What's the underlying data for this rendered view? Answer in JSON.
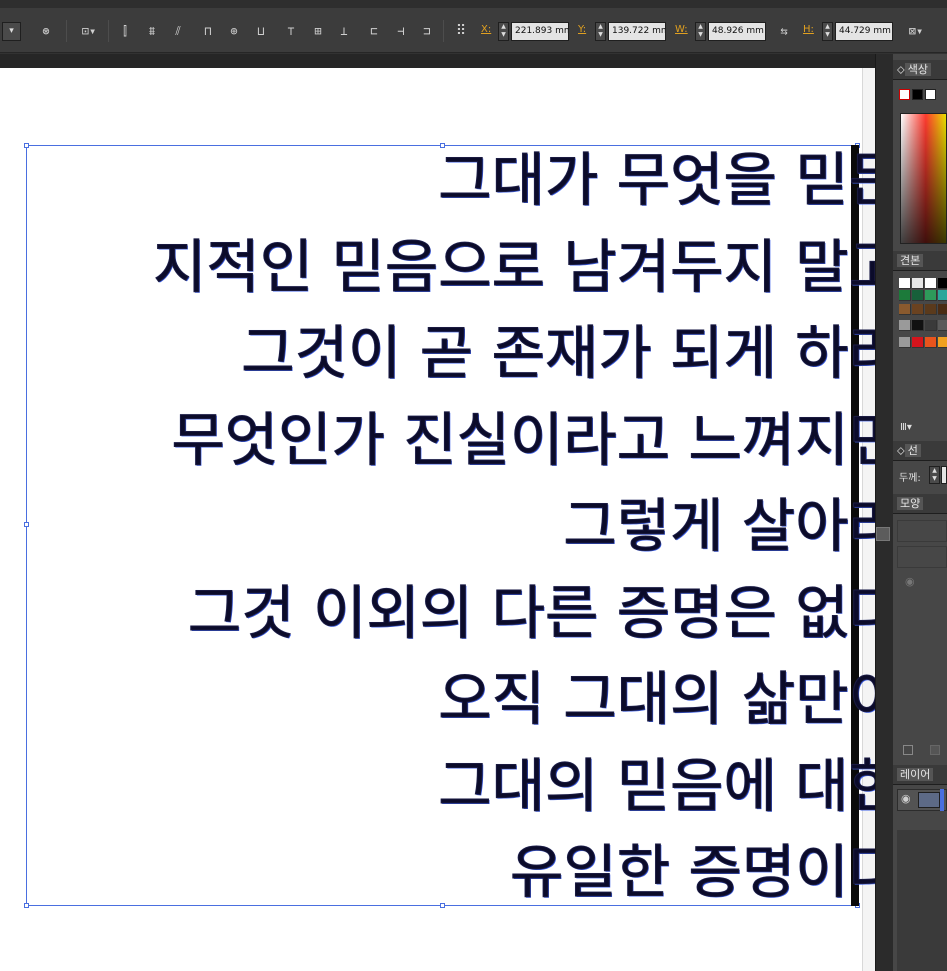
{
  "toolbar": {
    "stroke_dropdown_arrow": "▾",
    "globe_icon": "⊛",
    "transform_icon": "⊡▾",
    "align_icons": [
      "⫿",
      "⩩",
      "⫽",
      "⊓",
      "⊕",
      "⊔",
      "⊤",
      "⊞",
      "⊥",
      "⊏",
      "⊣",
      "⊐"
    ],
    "grid_icon": "⠿",
    "x_label": "X:",
    "y_label": "Y:",
    "w_label": "W:",
    "h_label": "H:",
    "x_value": "221.893 mm",
    "y_value": "139.722 mm",
    "w_value": "48.926 mm",
    "h_value": "44.729 mm",
    "link_icon": "⇆",
    "transform_menu_icon": "⊠▾"
  },
  "document": {
    "lines": [
      "그대가 무엇을 믿든",
      "지적인 믿음으로 남겨두지 말고",
      "그것이 곧 존재가 되게 하라",
      "무엇인가 진실이라고 느껴지면",
      "그렇게 살아라",
      "그것 이외의 다른 증명은 없다",
      "오직 그대의 삶만이",
      "그대의 믿음에 대한",
      "유일한 증명이다"
    ]
  },
  "panels": {
    "color_tab": "색상",
    "swatches_tab": "견본",
    "stroke_tab": "선",
    "stroke_weight_label": "두께:",
    "appearance_tab": "모양",
    "layers_tab": "레이어",
    "library_icon": "Ⅲ▾"
  },
  "colors": {
    "selection": "#4a6fe0",
    "text": "#0b0b2a",
    "field_label": "#e0a020",
    "panel_bg": "#474747"
  }
}
